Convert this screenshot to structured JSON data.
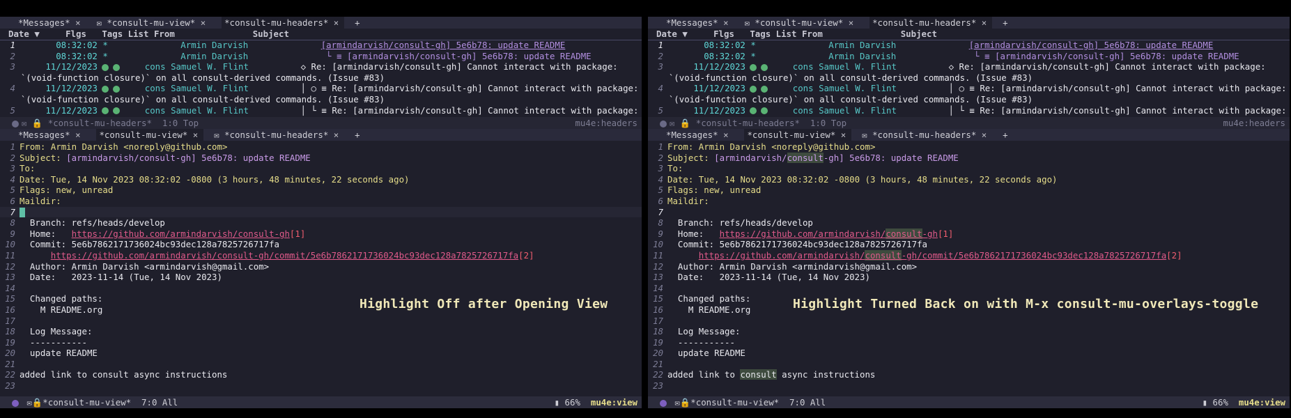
{
  "panels": [
    {
      "tabs_top": [
        "*Messages*",
        "*consult-mu-view*",
        "*consult-mu-headers*"
      ],
      "tabs_top_active": 2,
      "header_cols": [
        "Date",
        "Flgs",
        "Tags",
        "List",
        "From",
        "Subject"
      ],
      "headers": [
        {
          "n": "1",
          "time": "08:32:02",
          "flag": "*",
          "from": "Armin Darvish",
          "subj": "[armindarvish/consult-gh] 5e6b78: update README"
        },
        {
          "n": "2",
          "time": "08:32:02",
          "flag": "*",
          "from": "Armin Darvish",
          "subj": "└ ≡ [armindarvish/consult-gh] 5e6b78: update README"
        },
        {
          "n": "3",
          "time": "11/12/2023",
          "flag": "",
          "from": "cons Samuel W. Flint",
          "subj": "◇ Re: [armindarvish/consult-gh] Cannot interact with package:"
        },
        {
          "n": "",
          "wrap": "`(void-function closure)` on all consult-derived commands. (Issue #83)"
        },
        {
          "n": "4",
          "time": "11/12/2023",
          "flag": "",
          "from": "cons Samuel W. Flint",
          "subj": "│ ○ ≡ Re: [armindarvish/consult-gh] Cannot interact with package:"
        },
        {
          "n": "",
          "wrap": "`(void-function closure)` on all consult-derived commands. (Issue #83)"
        },
        {
          "n": "5",
          "time": "11/12/2023",
          "flag": "",
          "from": "cons Samuel W. Flint",
          "subj": "│ └ ≡ Re: [armindarvish/consult-gh] Cannot interact with package:"
        }
      ],
      "modeline_top": {
        "buffer": "*consult-mu-headers*",
        "pos": "1:0 Top",
        "mode": "mu4e:headers"
      },
      "tabs_mid": [
        "*Messages*",
        "*consult-mu-view*",
        "*consult-mu-headers*"
      ],
      "tabs_mid_active": 1,
      "view": {
        "from_label": "From:",
        "from_value": "Armin Darvish <noreply@github.com>",
        "subject_label": "Subject:",
        "subject_value": "[armindarvish/consult-gh] 5e6b78: update README",
        "to_label": "To:",
        "date_label": "Date:",
        "date_value": "Tue, 14 Nov 2023 08:32:02 -0800 (3 hours, 48 minutes, 22 seconds ago)",
        "flags_label": "Flags:",
        "flags_value": "new, unread",
        "maildir_label": "Maildir:",
        "branch": "  Branch: refs/heads/develop",
        "home_label": "  Home:   ",
        "home_link": "https://github.com/armindarvish/consult-gh",
        "home_ref": "[1]",
        "commit": "  Commit: 5e6b7862171736024bc93dec128a7825726717fa",
        "commit_link": "https://github.com/armindarvish/consult-gh/commit/5e6b7862171736024bc93dec128a7825726717fa",
        "commit_ref": "[2]",
        "author": "  Author: Armin Darvish <armindarvish@gmail.com>",
        "date2": "  Date:   2023-11-14 (Tue, 14 Nov 2023)",
        "changed": "  Changed paths:",
        "changed_file": "    M README.org",
        "log": "  Log Message:",
        "sep": "  -----------",
        "logmsg": "  update README",
        "added": "added link to consult async instructions"
      },
      "caption": "Highlight Off after Opening View",
      "modeline_bottom": {
        "buffer": "*consult-mu-view*",
        "pos": "7:0 All",
        "percent": "66%",
        "mode": "mu4e:view"
      }
    },
    {
      "caption": "Highlight Turned Back on with M-x consult-mu-overlays-toggle"
    }
  ]
}
